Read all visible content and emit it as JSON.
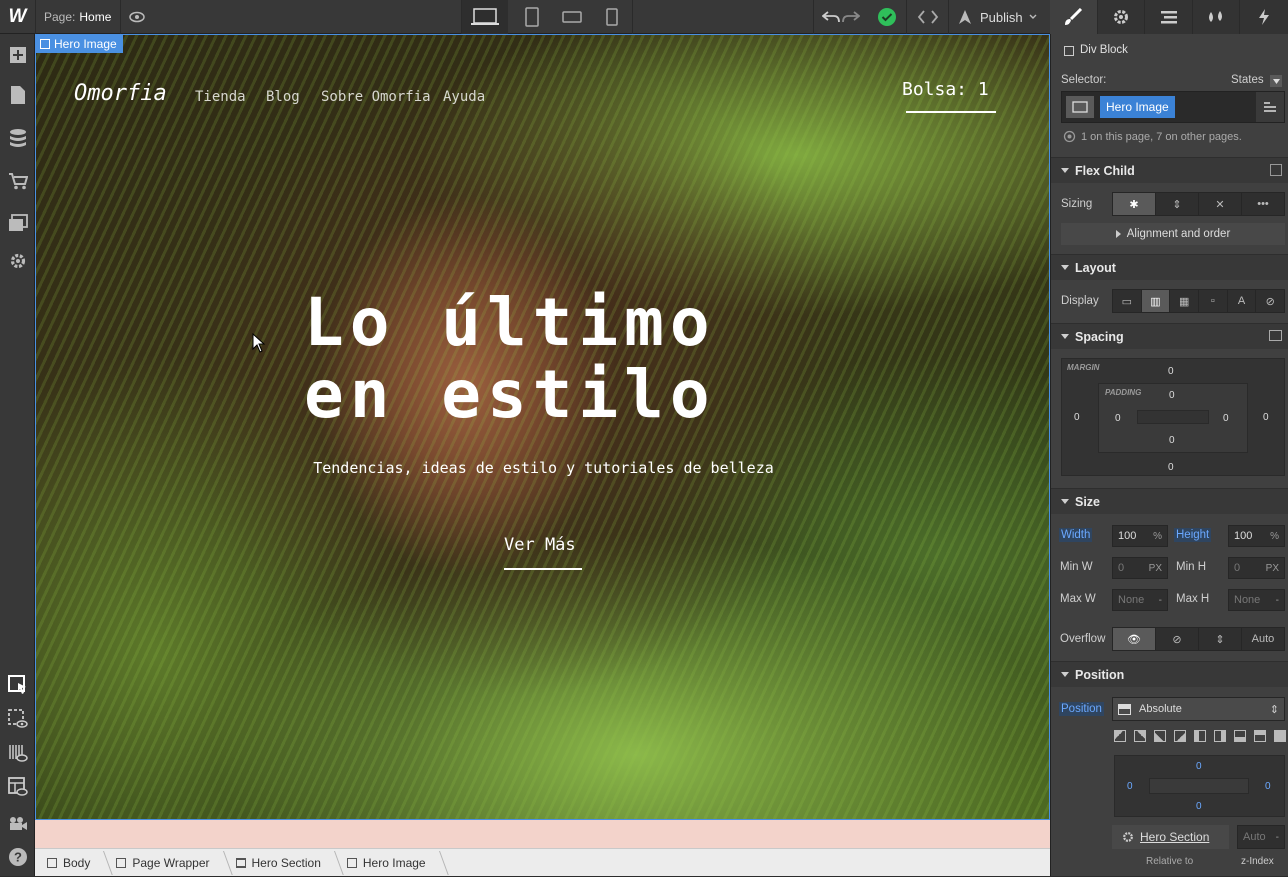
{
  "topbar": {
    "logo": "W",
    "page_label": "Page:",
    "page_name": "Home",
    "publish_label": "Publish"
  },
  "hero": {
    "tag": "Hero Image",
    "brand": "Omorfia",
    "nav": [
      "Tienda",
      "Blog",
      "Sobre Omorfia",
      "Ayuda"
    ],
    "bag": "Bolsa: 1",
    "headline_1": "Lo último",
    "headline_2": "en estilo",
    "subtitle": "Tendencias, ideas de estilo y tutoriales de belleza",
    "cta": "Ver Más"
  },
  "breadcrumbs": [
    "Body",
    "Page Wrapper",
    "Hero Section",
    "Hero Image"
  ],
  "panel": {
    "element_type": "Div Block",
    "selector_label": "Selector:",
    "states_label": "States",
    "selector_chip": "Hero Image",
    "usage_note": "1 on this page, 7 on other pages.",
    "flex_child": {
      "title": "Flex Child",
      "sizing_label": "Sizing",
      "alignment_label": "Alignment and order"
    },
    "layout": {
      "title": "Layout",
      "display_label": "Display"
    },
    "spacing": {
      "title": "Spacing",
      "margin_label": "MARGIN",
      "padding_label": "PADDING",
      "margin_top": "0",
      "margin_left": "0",
      "margin_right": "0",
      "margin_bottom": "0",
      "padding_top": "0",
      "padding_left": "0",
      "padding_right": "0",
      "padding_bottom": "0"
    },
    "size": {
      "title": "Size",
      "width_label": "Width",
      "width_value": "100",
      "width_unit": "%",
      "height_label": "Height",
      "height_value": "100",
      "height_unit": "%",
      "minw_label": "Min W",
      "minw_value": "0",
      "minw_unit": "PX",
      "minh_label": "Min H",
      "minh_value": "0",
      "minh_unit": "PX",
      "maxw_label": "Max W",
      "maxw_value": "None",
      "maxw_unit": "-",
      "maxh_label": "Max H",
      "maxh_value": "None",
      "maxh_unit": "-",
      "overflow_label": "Overflow",
      "overflow_auto": "Auto"
    },
    "position": {
      "title": "Position",
      "position_label": "Position",
      "position_value": "Absolute",
      "offset_top": "0",
      "offset_left": "0",
      "offset_right": "0",
      "offset_bottom": "0",
      "relative_parent": "Hero Section",
      "relative_to_label": "Relative to",
      "zindex_value": "Auto",
      "zindex_unit": "-",
      "zindex_label": "z-Index"
    }
  },
  "colors": {
    "accent": "#4a90e2",
    "status_ok": "#2fbf5a",
    "panel_bg": "#404040"
  }
}
